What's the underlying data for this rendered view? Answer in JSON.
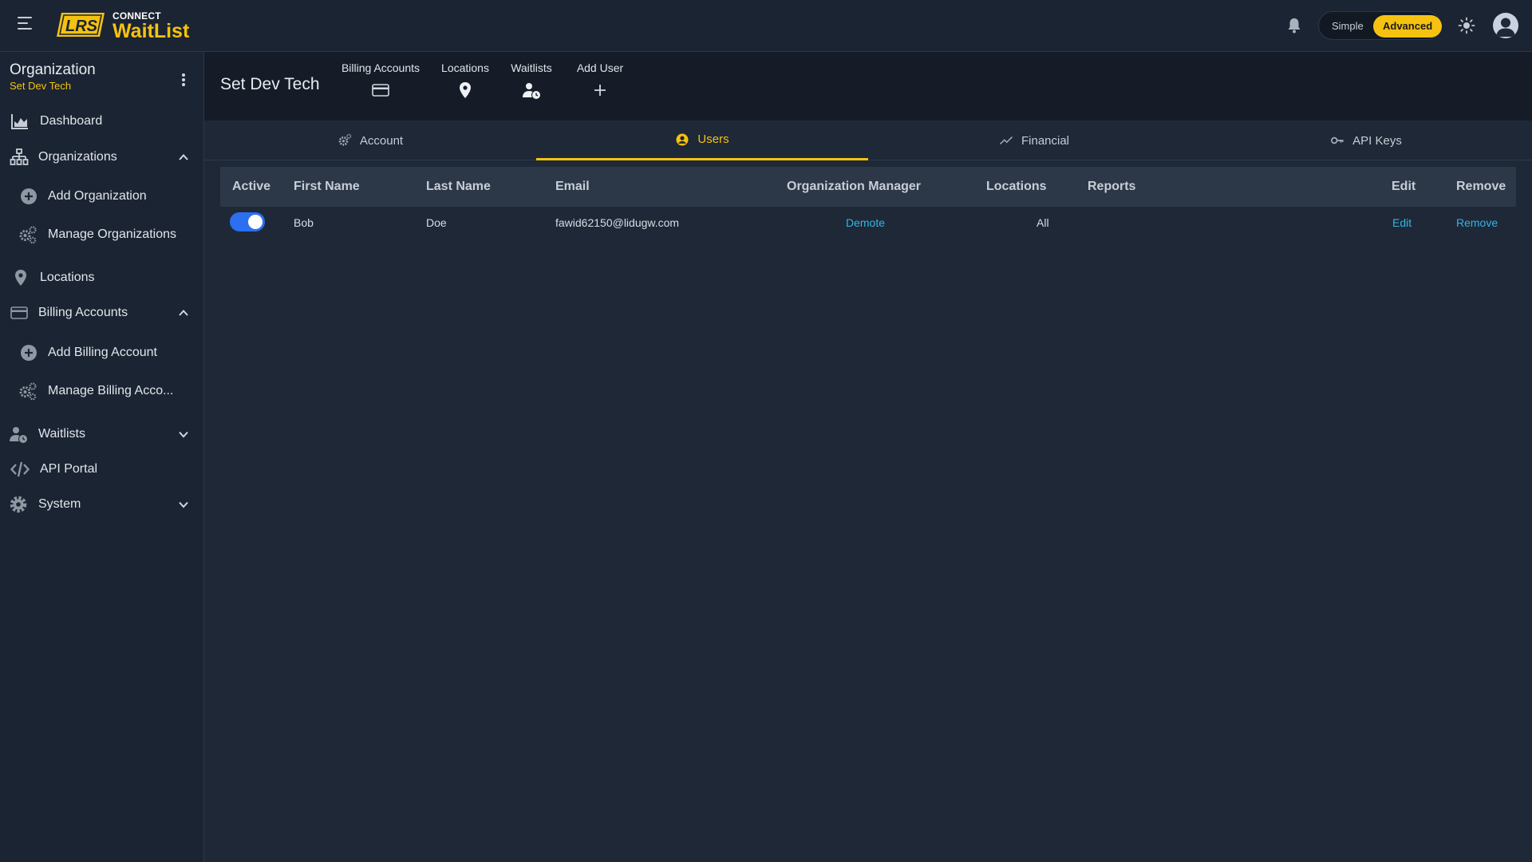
{
  "brand": {
    "logo_text": "LRS",
    "top_text": "CONNECT",
    "name": "WaitList"
  },
  "topbar": {
    "mode_simple": "Simple",
    "mode_advanced": "Advanced",
    "active_mode": "Advanced"
  },
  "colors": {
    "accent": "#f5c211",
    "link": "#33b4e6",
    "toggle": "#2c6ff0",
    "bg": "#1e2837"
  },
  "sidebar": {
    "title": "Organization",
    "subtitle": "Set Dev Tech",
    "items": [
      {
        "label": "Dashboard",
        "icon": "chart-area-icon"
      },
      {
        "label": "Organizations",
        "icon": "org-tree-icon",
        "expanded": true
      },
      {
        "label": "Add Organization",
        "icon": "plus-circle-icon"
      },
      {
        "label": "Manage Organizations",
        "icon": "gears-icon"
      },
      {
        "label": "Locations",
        "icon": "map-pin-icon"
      },
      {
        "label": "Billing Accounts",
        "icon": "credit-card-icon",
        "expanded": true
      },
      {
        "label": "Add Billing Account",
        "icon": "plus-circle-icon"
      },
      {
        "label": "Manage Billing Acco...",
        "icon": "gears-icon"
      },
      {
        "label": "Waitlists",
        "icon": "user-clock-icon",
        "expanded": false
      },
      {
        "label": "API Portal",
        "icon": "code-icon"
      },
      {
        "label": "System",
        "icon": "gear-icon",
        "expanded": false
      }
    ]
  },
  "header": {
    "title": "Set Dev Tech",
    "quick_links": [
      {
        "label": "Billing Accounts",
        "icon": "credit-card-icon"
      },
      {
        "label": "Locations",
        "icon": "map-pin-icon"
      },
      {
        "label": "Waitlists",
        "icon": "user-clock-icon"
      },
      {
        "label": "Add User",
        "icon": "plus-icon"
      }
    ]
  },
  "tabs": [
    {
      "label": "Account",
      "icon": "gear-icon",
      "active": false
    },
    {
      "label": "Users",
      "icon": "user-circle-icon",
      "active": true
    },
    {
      "label": "Financial",
      "icon": "trend-line-icon",
      "active": false
    },
    {
      "label": "API Keys",
      "icon": "key-icon",
      "active": false
    }
  ],
  "table": {
    "columns": [
      "Active",
      "First Name",
      "Last Name",
      "Email",
      "Organization Manager",
      "Locations",
      "Reports",
      "Edit",
      "Remove"
    ],
    "rows": [
      {
        "active": true,
        "first_name": "Bob",
        "last_name": "Doe",
        "email": "fawid62150@lidugw.com",
        "org_manager_action": "Demote",
        "locations": "All",
        "reports": "",
        "edit": "Edit",
        "remove": "Remove"
      }
    ]
  }
}
